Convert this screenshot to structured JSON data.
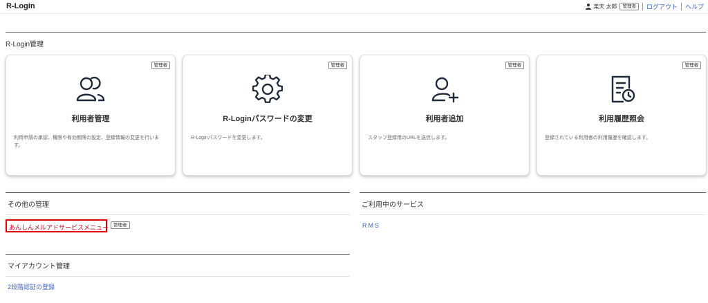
{
  "app": {
    "title": "R-Login"
  },
  "header": {
    "user_name": "楽天 太郎",
    "role_badge": "管理者",
    "logout_label": "ログアウト",
    "help_label": "ヘルプ"
  },
  "rlogin_section": {
    "title": "R-Login管理",
    "cards": [
      {
        "badge": "管理者",
        "icon": "users-icon",
        "title": "利用者管理",
        "desc": "利用申請の承認、権限や有効期限の設定、登録情報の変更を行います。"
      },
      {
        "badge": "管理者",
        "icon": "gear-icon",
        "title": "R-Loginパスワードの変更",
        "desc": "R-Loginパスワードを変更します。"
      },
      {
        "badge": "管理者",
        "icon": "add-user-icon",
        "title": "利用者追加",
        "desc": "スタッフ登録用のURLを送信します。"
      },
      {
        "badge": "管理者",
        "icon": "history-document-icon",
        "title": "利用履歴照会",
        "desc": "登録されている利用者の利用履歴を確認します。"
      }
    ]
  },
  "other_section": {
    "title": "その他の管理",
    "item_label": "あんしんメルアドサービスメニュー",
    "item_badge": "管理者"
  },
  "services_section": {
    "title": "ご利用中のサービス",
    "item_label": "RMS"
  },
  "account_section": {
    "title": "マイアカウント管理",
    "item_label": "2段階認証の登録"
  },
  "colors": {
    "link": "#3a63c9",
    "highlight_border": "#e00000",
    "highlight_text": "#d0021b"
  }
}
